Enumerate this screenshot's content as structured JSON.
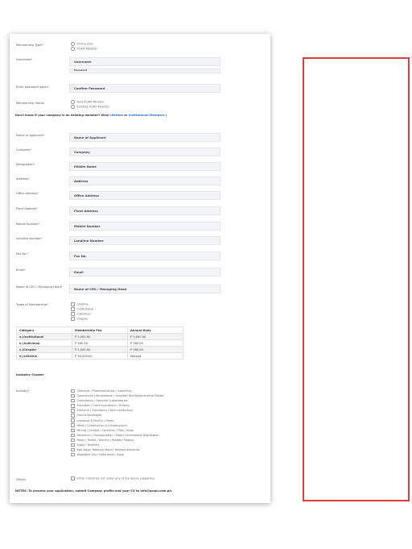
{
  "form": {
    "membership_type": {
      "label": "Membership Type",
      "options": [
        "Online User",
        "PCAPI Member"
      ]
    },
    "username": {
      "label": "Username",
      "placeholder": "Username"
    },
    "password_partial": "Password",
    "confirm": {
      "label": "Enter password again",
      "placeholder": "Confirm Password"
    },
    "status": {
      "label": "Membership Status",
      "options": [
        "New PCAPI Member",
        "Existing PCAPI Member"
      ]
    },
    "existing_note": {
      "prefix": "Don't know if your company is an existing member? View",
      "link1": "Lifetime",
      "mid": "or",
      "link2": "Institutional Members",
      "suffix": ")"
    },
    "fields": [
      {
        "label": "Name of Applicant",
        "req": "*",
        "placeholder": "Name of Applicant"
      },
      {
        "label": "Company",
        "req": "*",
        "placeholder": "Company"
      },
      {
        "label": "Designation",
        "req": "*",
        "placeholder": "Middle Name"
      },
      {
        "label": "Address",
        "req": "*",
        "placeholder": "Address"
      },
      {
        "label": "Office Address",
        "req": "*",
        "placeholder": "Office Address"
      },
      {
        "label": "Plant Address",
        "req": "*",
        "placeholder": "Plant Address"
      },
      {
        "label": "Mobile Number",
        "req": "*",
        "placeholder": "Mobile Number"
      },
      {
        "label": "Landline Number",
        "req": "*",
        "placeholder": "Landline Number"
      },
      {
        "label": "Fax No.",
        "req": "*",
        "placeholder": "Fax No."
      },
      {
        "label": "Email",
        "req": "*",
        "placeholder": "Email"
      },
      {
        "label": "Name of CEO / Managing Head",
        "req": "*",
        "placeholder": "Name of CEO / Managing Head"
      }
    ],
    "types": {
      "label": "Types of Membership",
      "options": [
        "Lifetime",
        "Institutional",
        "Individual",
        "Chapter"
      ]
    },
    "fees": {
      "headers": [
        "Category",
        "Membership Fee",
        "Annual Dues"
      ],
      "rows": [
        [
          "a.)Institutional",
          "P 3,000.00",
          "P 3,000.00"
        ],
        [
          "b.)Individual",
          "P 560.00",
          "P 560.00"
        ],
        [
          "c.)Chapter",
          "P 5,000.00",
          "P 560.00"
        ],
        [
          "d.)Lifetime",
          "P 30,000.00",
          "Waived"
        ]
      ]
    },
    "industry_cluster": "Industry Cluster",
    "industry": {
      "label": "Industry",
      "options": [
        "Chemical / Pharmaceuticals / Cosmetics",
        "Commercial / Recreational / Hospital/ Facilities/Industrial Estate",
        "Consultancy / Services / Laboratories",
        "Education / Communications / Printing",
        "Electrical / Electronics / Semi-conductors",
        "Food & Beverages",
        "Livestock & Poultry / Feeds",
        "Metal / Construction & Infrastructure",
        "Mining / Cement / Ceramics / Tiles / Glass",
        "Petroleum / Transportation / Power Generation& Distribution",
        "Paper / Textile / Tannery / Rubber/ Plastics",
        "Sugar / Distillery",
        "Agri-Aqua/ Tobacco/ Wood / Related Industries",
        "Vegetable Oils / Detergents / Soap"
      ]
    },
    "others": {
      "label": "Others",
      "option": "Other industries not under any of the above categories"
    },
    "notes": "NOTES: To process your application, submit Company profile and your CV to info@pcapi.com.ph."
  }
}
